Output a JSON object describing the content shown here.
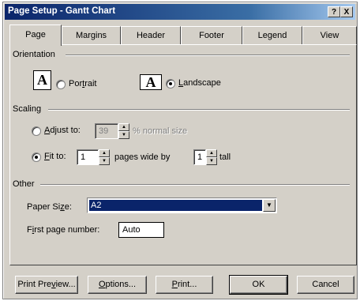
{
  "window": {
    "title": "Page Setup - Gantt Chart",
    "help_label": "?",
    "close_label": "X"
  },
  "tabs": [
    {
      "label": "Page",
      "active": true
    },
    {
      "label": "Margins"
    },
    {
      "label": "Header"
    },
    {
      "label": "Footer"
    },
    {
      "label": "Legend"
    },
    {
      "label": "View"
    }
  ],
  "orientation": {
    "group_label": "Orientation",
    "icon_glyph": "A",
    "portrait": {
      "prefix": "Por",
      "accel": "t",
      "suffix": "rait",
      "selected": false
    },
    "landscape": {
      "prefix": "",
      "accel": "L",
      "suffix": "andscape",
      "selected": true
    }
  },
  "scaling": {
    "group_label": "Scaling",
    "adjust": {
      "prefix": "",
      "accel": "A",
      "suffix": "djust to:",
      "value": "39",
      "unit": "% normal size",
      "selected": false,
      "disabled": true
    },
    "fit": {
      "prefix": "",
      "accel": "F",
      "suffix": "it to:",
      "wide_value": "1",
      "wide_label": "pages wide by",
      "tall_value": "1",
      "tall_label": "tall",
      "selected": true
    }
  },
  "other": {
    "group_label": "Other",
    "paper_size": {
      "prefix": "Paper Si",
      "accel": "z",
      "suffix": "e:",
      "value": "A2"
    },
    "first_page": {
      "prefix": "F",
      "accel": "i",
      "suffix": "rst page number:",
      "value": "Auto"
    }
  },
  "buttons": {
    "print_preview": {
      "prefix": "Print Pre",
      "accel": "v",
      "suffix": "iew..."
    },
    "options": {
      "prefix": "",
      "accel": "O",
      "suffix": "ptions..."
    },
    "print": {
      "prefix": "",
      "accel": "P",
      "suffix": "rint..."
    },
    "ok": "OK",
    "cancel": "Cancel"
  },
  "icons": {
    "spin_up": "▲",
    "spin_down": "▼",
    "dropdown": "▼"
  }
}
